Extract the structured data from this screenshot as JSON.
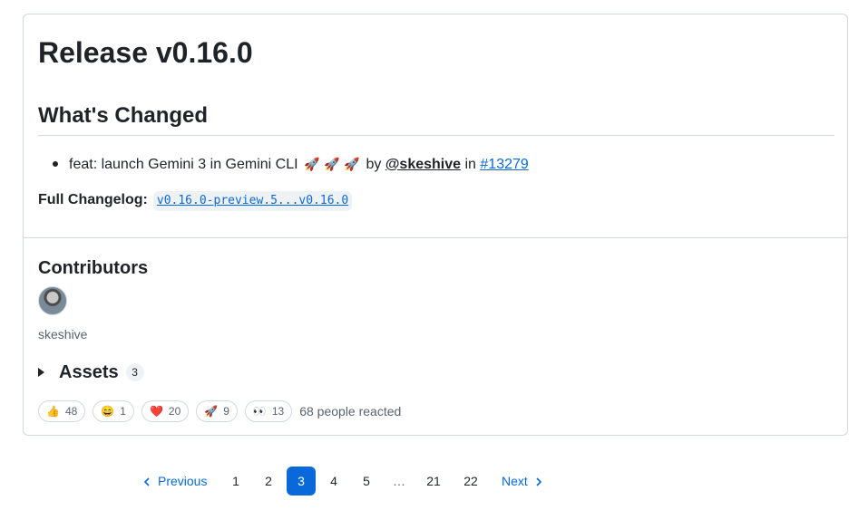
{
  "release": {
    "title": "Release v0.16.0",
    "section_heading": "What's Changed",
    "change": {
      "text": "feat: launch Gemini 3 in Gemini CLI",
      "rocket_emoji": "🚀",
      "by": "by",
      "author": "@skeshive",
      "in": "in",
      "pr": "#13279"
    },
    "changelog_label": "Full Changelog:",
    "changelog_link": "v0.16.0-preview.5...v0.16.0"
  },
  "contributors": {
    "heading": "Contributors",
    "name": "skeshive"
  },
  "assets": {
    "label": "Assets",
    "count": "3"
  },
  "reactions": {
    "items": [
      {
        "emoji": "👍",
        "count": "48"
      },
      {
        "emoji": "😄",
        "count": "1"
      },
      {
        "emoji": "❤️",
        "count": "20"
      },
      {
        "emoji": "🚀",
        "count": "9"
      },
      {
        "emoji": "👀",
        "count": "13"
      }
    ],
    "summary": "68 people reacted"
  },
  "pagination": {
    "previous": "Previous",
    "next": "Next",
    "prev_icon": "chevron-left-icon",
    "next_icon": "chevron-right-icon",
    "pages": [
      "1",
      "2",
      "3",
      "4",
      "5",
      "…",
      "21",
      "22"
    ],
    "current": "3"
  },
  "colors": {
    "accent": "#0969da",
    "text": "#1f2328",
    "muted": "#59636e",
    "border": "#d1d9e0"
  }
}
